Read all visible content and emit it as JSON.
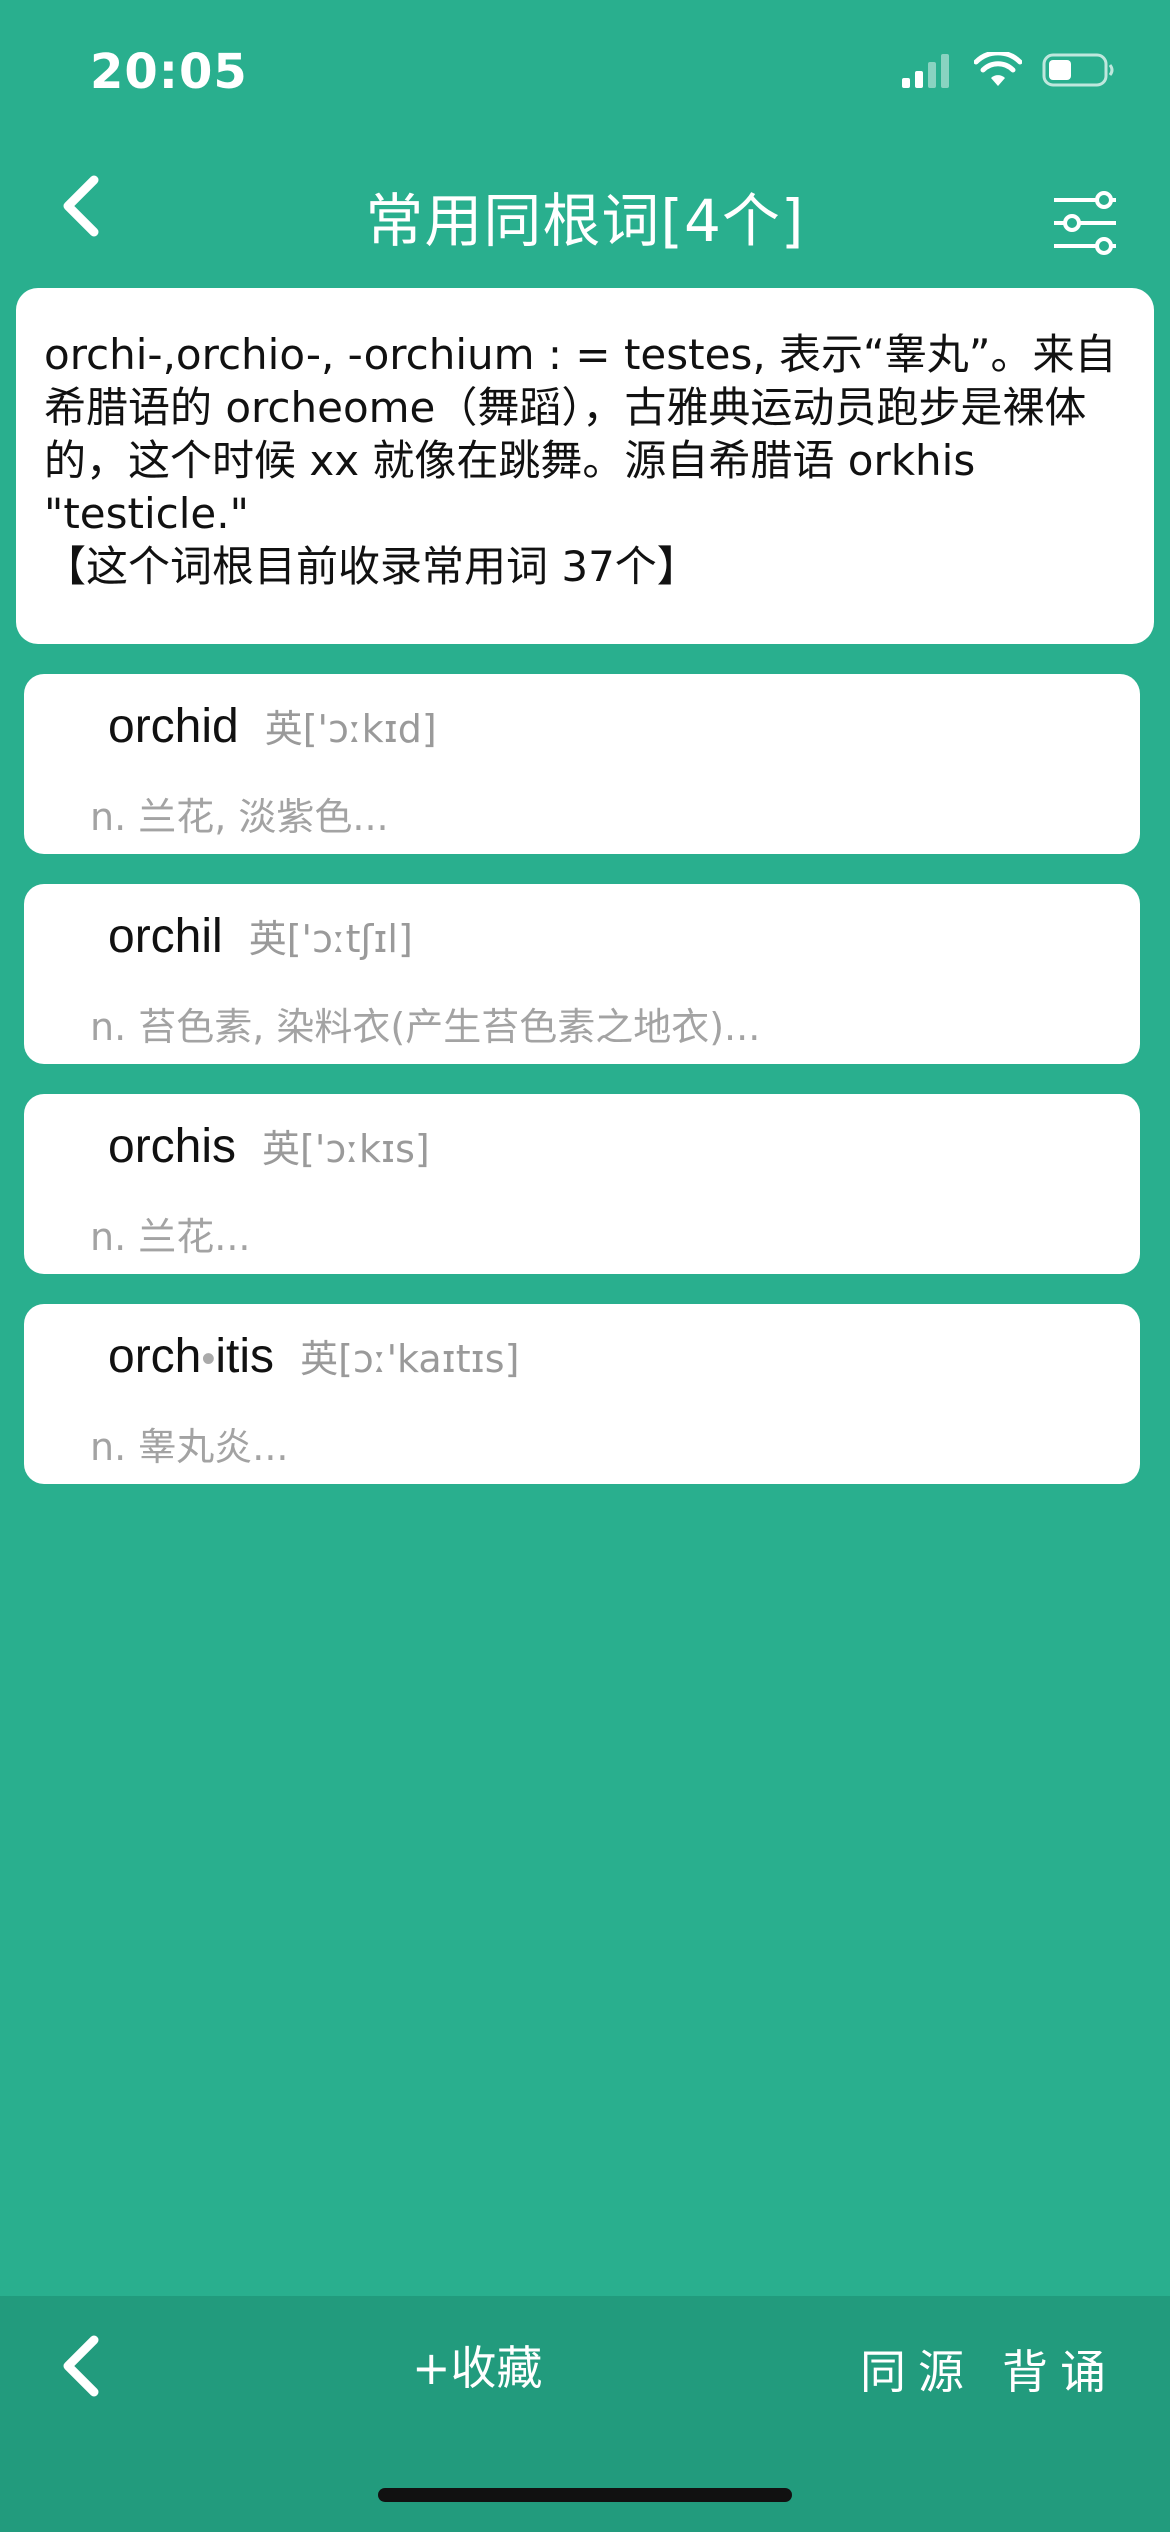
{
  "status": {
    "time": "20:05",
    "signal_icon": "cellular-signal-icon",
    "wifi_icon": "wifi-icon",
    "battery_icon": "battery-icon"
  },
  "header": {
    "title": "常用同根词[4个]",
    "back_icon": "chevron-left-icon",
    "filter_icon": "sliders-icon"
  },
  "root": {
    "description": "orchi-,orchio-, -orchium : = testes, 表示“睾丸”。来自希腊语的 orcheome（舞蹈），古雅典运动员跑步是裸体的，这个时候 xx 就像在跳舞。源自希腊语 orkhis \"testicle.\"\n【这个词根目前收录常用词 37个】"
  },
  "words": [
    {
      "word": "orchid",
      "phonetic": "英['ɔːkɪd]",
      "definition": "n. 兰花, 淡紫色..."
    },
    {
      "word": "orchil",
      "phonetic": "英['ɔːtʃɪl]",
      "definition": "n. 苔色素, 染料衣(产生苔色素之地衣)..."
    },
    {
      "word": "orchis",
      "phonetic": "英['ɔːkɪs]",
      "definition": "n. 兰花..."
    },
    {
      "word_a": "orch",
      "word_dot": "•",
      "word_b": "itis",
      "phonetic": "英[ɔː'kaɪtɪs]",
      "definition": "n. 睾丸炎..."
    }
  ],
  "bottom": {
    "back_icon": "chevron-left-icon",
    "collect_label": "+收藏",
    "same_source_label": "同源",
    "recite_label": "背诵"
  },
  "colors": {
    "background": "#29af8e",
    "bottom_bar": "#229b7d",
    "card": "#ffffff"
  }
}
